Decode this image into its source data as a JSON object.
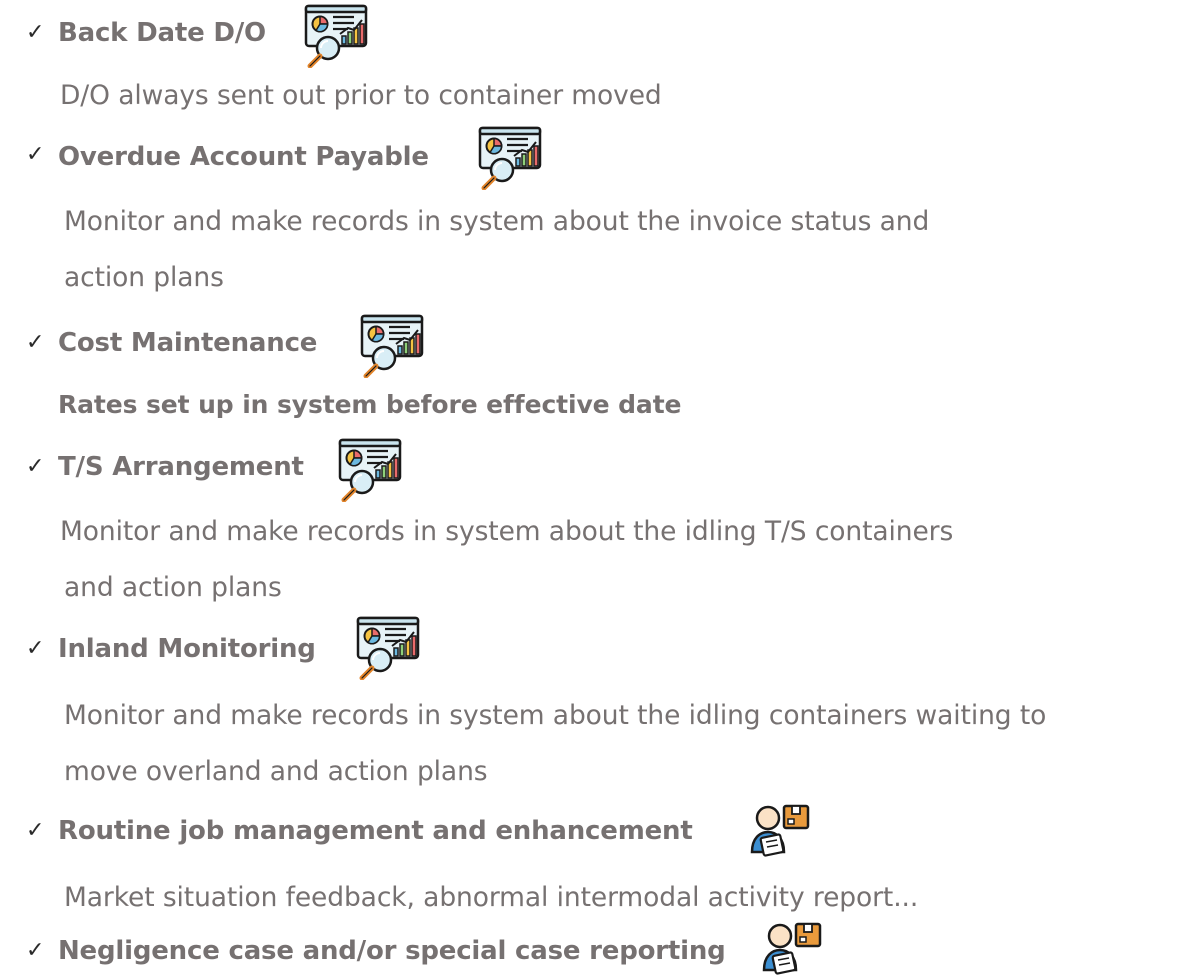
{
  "items": [
    {
      "title": "Back Date D/O",
      "icon": "dashboard-magnifier-icon",
      "desc": [
        "D/O always sent out prior to container moved"
      ]
    },
    {
      "title": "Overdue Account Payable",
      "icon": "dashboard-magnifier-icon",
      "desc": [
        "Monitor and make records in system about the invoice status and",
        "action plans"
      ]
    },
    {
      "title": "Cost Maintenance",
      "icon": "dashboard-magnifier-icon",
      "desc": [
        "Rates set up in system before effective date"
      ]
    },
    {
      "title": "T/S Arrangement",
      "icon": "dashboard-magnifier-icon",
      "desc": [
        "Monitor and make records in system about the idling T/S containers",
        "and action plans"
      ]
    },
    {
      "title": "Inland Monitoring",
      "icon": "dashboard-magnifier-icon",
      "desc": [
        "Monitor and make records in system about the idling containers waiting to",
        "move overland and action plans"
      ]
    },
    {
      "title": "Routine job management and enhancement",
      "icon": "worker-clipboard-box-icon",
      "desc": [
        "Market situation feedback, abnormal intermodal activity report..."
      ]
    },
    {
      "title": "Negligence case and/or special case reporting",
      "icon": "worker-clipboard-box-icon",
      "desc": []
    }
  ],
  "check_symbol": "✓"
}
